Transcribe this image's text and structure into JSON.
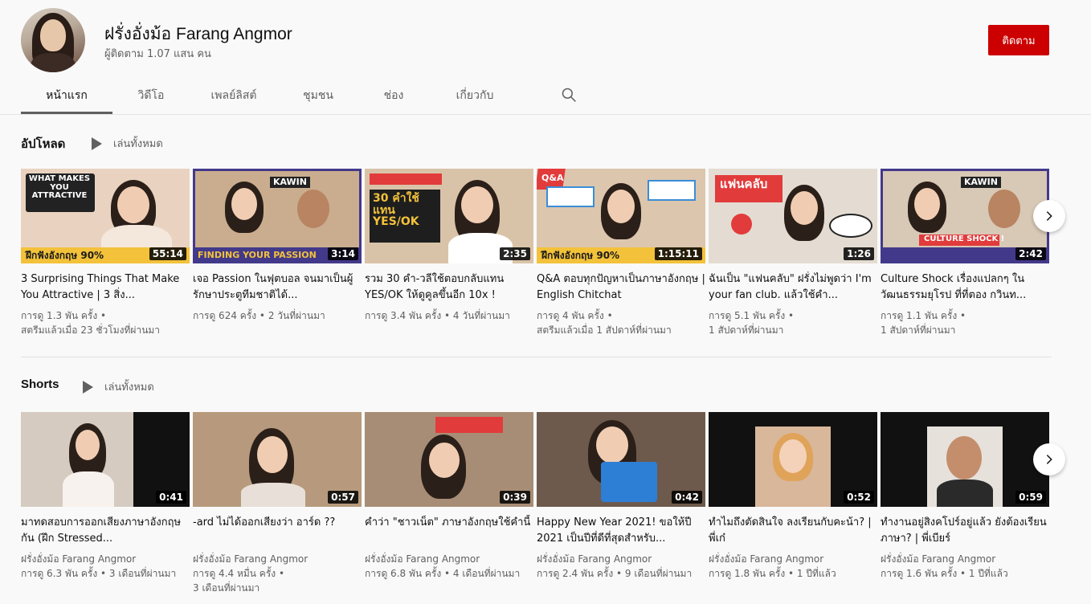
{
  "channel": {
    "name": "ฝรั่งอั่งม้อ Farang Angmor",
    "subscribers": "ผู้ติดตาม 1.07 แสน คน",
    "subscribe_label": "ติดตาม"
  },
  "tabs": [
    {
      "label": "หน้าแรก",
      "active": true
    },
    {
      "label": "วิดีโอ"
    },
    {
      "label": "เพลย์ลิสต์"
    },
    {
      "label": "ชุมชน"
    },
    {
      "label": "ช่อง"
    },
    {
      "label": "เกี่ยวกับ"
    }
  ],
  "uploads": {
    "title": "อัปโหลด",
    "play_all": "เล่นทั้งหมด",
    "videos": [
      {
        "title": "3 Surprising Things That Make You Attractive | 3 สิ่ง...",
        "meta1": "การดู 1.3 พัน ครั้ง •",
        "meta2": "สตรีมแล้วเมื่อ 23 ชั่วโมงที่ผ่านมา",
        "duration": "55:14",
        "thumb_text": "WHAT MAKES YOU ATTRACTIVE",
        "bottom_text": "ฝึกฟังอังกฤษ 90%",
        "bg": "#e9d3c0",
        "accent": "#f3c23a"
      },
      {
        "title": "เจอ Passion ในฟุตบอล จนมาเป็นผู้รักษาประตูทีมชาติได้...",
        "meta1": "การดู 624 ครั้ง • 2 วันที่ผ่านมา",
        "meta2": "",
        "duration": "3:14",
        "thumb_text": "KAWIN",
        "bottom_text": "FINDING YOUR PASSION",
        "bg": "#cfb79a",
        "accent": "#f3c23a"
      },
      {
        "title": "รวม 30 คำ-วลีใช้ตอบกลับแทน YES/OK ให้ดูคูลขึ้นอีก 10x !",
        "meta1": "การดู 3.4 พัน ครั้ง • 4 วันที่ผ่านมา",
        "meta2": "",
        "duration": "2:35",
        "thumb_text": "30 คำใช้แทน YES/OK",
        "bottom_text": "",
        "bg": "#d9c3a8",
        "accent": "#e23b3b"
      },
      {
        "title": "Q&A ตอบทุกปัญหาเป็นภาษาอังกฤษ | English Chitchat",
        "meta1": "การดู 4 พัน ครั้ง •",
        "meta2": "สตรีมแล้วเมื่อ 1 สัปดาห์ที่ผ่านมา",
        "duration": "1:15:11",
        "thumb_text": "Q&A",
        "bottom_text": "ฝึกฟังอังกฤษ 90%",
        "bg": "#dcc6ad",
        "accent": "#f3c23a"
      },
      {
        "title": "ฉันเป็น \"แฟนคลับ\" ฝรั่งไม่พูดว่า I'm your fan club. แล้วใช้คำ...",
        "meta1": "การดู 5.1 พัน ครั้ง •",
        "meta2": "1 สัปดาห์ที่ผ่านมา",
        "duration": "1:26",
        "thumb_text": "แฟนคลับ",
        "bottom_text": "",
        "bg": "#e4dcd2",
        "accent": "#e23b3b"
      },
      {
        "title": "Culture Shock เรื่องแปลกๆ ในวัฒนธรรมยุโรป ที่ที่ตอง กวินท...",
        "meta1": "การดู 1.1 พัน ครั้ง •",
        "meta2": "1 สัปดาห์ที่ผ่านมา",
        "duration": "2:42",
        "thumb_text": "KAWIN",
        "bottom_text": "CULTURE SHOCK !",
        "bg": "#d8c8b6",
        "accent": "#e23b3b"
      }
    ]
  },
  "shorts": {
    "title": "Shorts",
    "play_all": "เล่นทั้งหมด",
    "videos": [
      {
        "title": "มาทดสอบการออกเสียงภาษาอังกฤษกัน (ฝึก Stressed...",
        "meta1": "ฝรั่งอั่งม้อ Farang Angmor",
        "meta2": "การดู 6.3 พัน ครั้ง • 3 เดือนที่ผ่านมา",
        "duration": "0:41",
        "bg": "#d6cbc1"
      },
      {
        "title": "-ard ไม่ได้ออกเสียงว่า อาร์ด ??",
        "meta1": "ฝรั่งอั่งม้อ Farang Angmor",
        "meta2": "การดู 4.4 หมื่น ครั้ง •",
        "meta3": "3 เดือนที่ผ่านมา",
        "duration": "0:57",
        "bg": "#b79a7d"
      },
      {
        "title": "คำว่า \"ชาวเน็ต\" ภาษาอังกฤษใช้คำนี้",
        "meta1": "ฝรั่งอั่งม้อ Farang Angmor",
        "meta2": "การดู 6.8 พัน ครั้ง • 4 เดือนที่ผ่านมา",
        "duration": "0:39",
        "bg": "#a88d76"
      },
      {
        "title": "Happy New Year 2021! ขอให้ปี 2021 เป็นปีที่ดีที่สุดสำหรับ...",
        "meta1": "ฝรั่งอั่งม้อ Farang Angmor",
        "meta2": "การดู 2.4 พัน ครั้ง • 9 เดือนที่ผ่านมา",
        "duration": "0:42",
        "bg": "#6d5a4c"
      },
      {
        "title": "ทำไมถึงตัดสินใจ ลงเรียนกับคะน้า? | พี่เก๋",
        "meta1": "ฝรั่งอั่งม้อ Farang Angmor",
        "meta2": "การดู 1.8 พัน ครั้ง • 1 ปีที่แล้ว",
        "duration": "0:52",
        "bg": "#111111"
      },
      {
        "title": "ทำงานอยู่สิงคโปร์อยู่แล้ว ยังต้องเรียนภาษา? | พี่เบียร์",
        "meta1": "ฝรั่งอั่งม้อ Farang Angmor",
        "meta2": "การดู 1.6 พัน ครั้ง • 1 ปีที่แล้ว",
        "duration": "0:59",
        "bg": "#111111"
      }
    ]
  },
  "icons": {
    "search": "search-icon",
    "next": "chevron-right-icon",
    "play": "play-icon"
  }
}
